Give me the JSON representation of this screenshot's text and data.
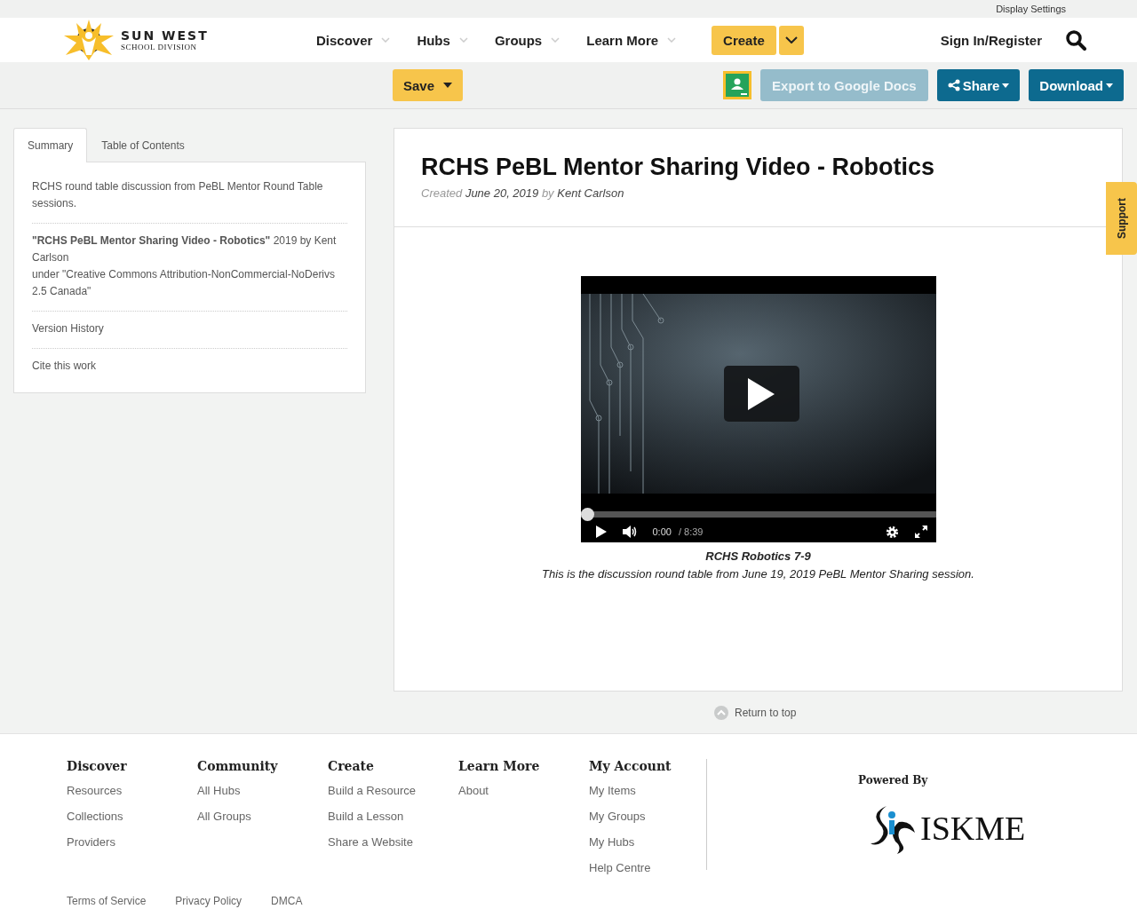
{
  "top_bar": {
    "display_settings": "Display Settings"
  },
  "header": {
    "logo": {
      "name": "SUN WEST",
      "subtitle": "SCHOOL DIVISION"
    },
    "nav": [
      {
        "label": "Discover"
      },
      {
        "label": "Hubs"
      },
      {
        "label": "Groups"
      },
      {
        "label": "Learn More"
      }
    ],
    "create": "Create",
    "sign_in": "Sign In/Register"
  },
  "toolbar": {
    "save": "Save",
    "export": {
      "label": "Export to Google Docs",
      "disabled": true
    },
    "share": "Share",
    "download": "Download"
  },
  "sidebar": {
    "tabs": [
      {
        "label": "Summary",
        "selected": true
      },
      {
        "label": "Table of Contents",
        "selected": false
      }
    ],
    "description": "RCHS round table discussion from PeBL Mentor Round Table sessions.",
    "attribution": "**\"RCHS PeBL Mentor Sharing Video - Robotics\"** 2019 by Kent Carlson",
    "license": "under \"Creative Commons Attribution-NonCommercial-NoDerivs 2.5 Canada\"",
    "links": [
      "Version History",
      "Cite this work"
    ]
  },
  "resource": {
    "title": "RCHS PeBL Mentor Sharing Video - Robotics",
    "meta": "Created **June 20, 2019** by **Kent Carlson**",
    "video": {
      "current": "0:00",
      "duration": "/ 8:39",
      "level": 0
    },
    "caption_title": "RCHS Robotics 7-9",
    "caption": "This is the discussion round table from June 19, 2019 PeBL Mentor Sharing session."
  },
  "support": "Support",
  "return_to_top": "Return to top",
  "footer": {
    "columns": [
      {
        "heading": "Discover",
        "links": [
          "Resources",
          "Collections",
          "Providers"
        ]
      },
      {
        "heading": "Community",
        "links": [
          "All Hubs",
          "All Groups"
        ]
      },
      {
        "heading": "Create",
        "links": [
          "Build a Resource",
          "Build a Lesson",
          "Share a Website"
        ]
      },
      {
        "heading": "Learn More",
        "links": [
          "About"
        ]
      },
      {
        "heading": "My Account",
        "links": [
          "My Items",
          "My Groups",
          "My Hubs",
          "Help Centre"
        ]
      }
    ],
    "legal": [
      "Terms of Service",
      "Privacy Policy",
      "DMCA"
    ],
    "powered_by": "Powered By",
    "iskme": "ISKME"
  }
}
